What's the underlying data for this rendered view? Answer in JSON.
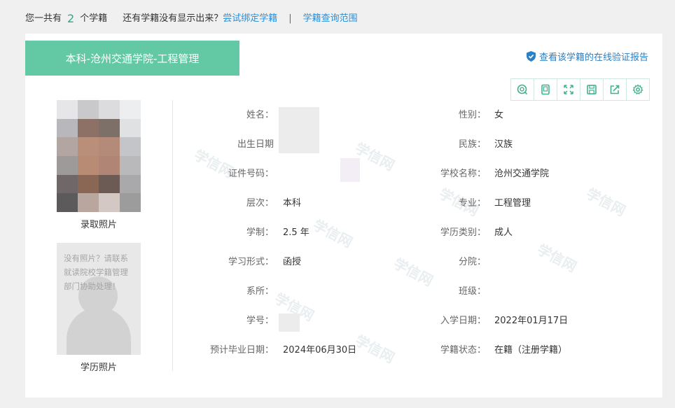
{
  "top_bar": {
    "prefix": "您一共有",
    "count": "2",
    "suffix": "个学籍",
    "question": "还有学籍没有显示出来？",
    "bind_link": "尝试绑定学籍",
    "separator": "|",
    "scope_link": "学籍查询范围"
  },
  "card": {
    "ribbon_title": "本科-沧州交通学院-工程管理",
    "verify_link": "查看该学籍的在线验证报告",
    "toolbar_icons": [
      "search-icon",
      "tablet-icon",
      "fullscreen-icon",
      "save-icon",
      "share-icon",
      "settings-icon"
    ],
    "photo1_caption": "录取照片",
    "photo2_message": "没有照片？请联系就读院校学籍管理部门协助处理！",
    "photo2_caption": "学历照片",
    "watermark": "学信网",
    "fields_left": [
      {
        "label": "姓名：",
        "value": ""
      },
      {
        "label": "出生日期",
        "value": ""
      },
      {
        "label": "证件号码：",
        "value": ""
      },
      {
        "label": "层次：",
        "value": "本科"
      },
      {
        "label": "学制：",
        "value": "2.5 年"
      },
      {
        "label": "学习形式：",
        "value": "函授"
      },
      {
        "label": "系所：",
        "value": ""
      },
      {
        "label": "学号：",
        "value": ""
      },
      {
        "label": "预计毕业日期：",
        "value": "2024年06月30日"
      }
    ],
    "fields_right": [
      {
        "label": "性别：",
        "value": "女"
      },
      {
        "label": "民族：",
        "value": "汉族"
      },
      {
        "label": "学校名称：",
        "value": "沧州交通学院"
      },
      {
        "label": "专业：",
        "value": "工程管理"
      },
      {
        "label": "学历类别：",
        "value": "成人"
      },
      {
        "label": "分院：",
        "value": ""
      },
      {
        "label": "班级：",
        "value": ""
      },
      {
        "label": "入学日期：",
        "value": "2022年01月17日"
      },
      {
        "label": "学籍状态：",
        "value": "在籍（注册学籍）"
      }
    ]
  },
  "colors": {
    "accent": "#63c9a4",
    "count": "#2aa889",
    "link": "#2b8fd6",
    "verify": "#2b80c6",
    "toolbar_icon": "#3fb28a"
  }
}
